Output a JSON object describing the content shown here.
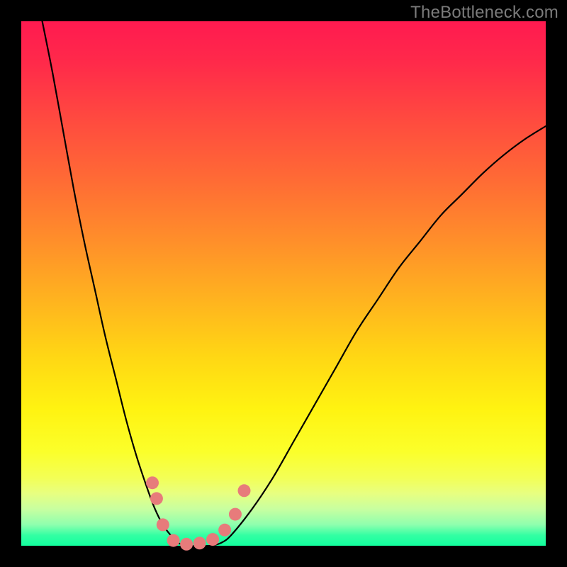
{
  "watermark": "TheBottleneck.com",
  "colors": {
    "frame": "#000000",
    "curve": "#000000",
    "marker_fill": "#e77b7b",
    "marker_stroke": "#d86a6a"
  },
  "chart_data": {
    "type": "line",
    "title": "",
    "xlabel": "",
    "ylabel": "",
    "xlim": [
      0,
      100
    ],
    "ylim": [
      0,
      100
    ],
    "note": "No axis ticks or numeric labels are rendered; values are in percent of plot area. y=0 is bottom edge, y=100 is top edge.",
    "series": [
      {
        "name": "left-branch",
        "x": [
          4,
          6,
          8,
          10,
          12,
          14,
          16,
          18,
          20,
          22,
          24,
          25.5,
          27,
          28.5,
          30
        ],
        "y": [
          100,
          90,
          79,
          68,
          58,
          49,
          40,
          32,
          24,
          17,
          11,
          7,
          4,
          2,
          0.5
        ]
      },
      {
        "name": "valley-floor",
        "x": [
          30,
          32,
          34,
          36,
          38
        ],
        "y": [
          0.5,
          0,
          0,
          0,
          0.5
        ]
      },
      {
        "name": "right-branch",
        "x": [
          38,
          40,
          44,
          48,
          52,
          56,
          60,
          64,
          68,
          72,
          76,
          80,
          84,
          88,
          92,
          96,
          100
        ],
        "y": [
          0.5,
          2,
          7,
          13,
          20,
          27,
          34,
          41,
          47,
          53,
          58,
          63,
          67,
          71,
          74.5,
          77.5,
          80
        ]
      }
    ],
    "markers": {
      "name": "highlighted-points",
      "x": [
        25.0,
        25.8,
        27.0,
        29.0,
        31.5,
        34.0,
        36.5,
        38.8,
        40.8,
        42.5
      ],
      "y": [
        12.0,
        9.0,
        4.0,
        1.0,
        0.3,
        0.5,
        1.2,
        3.0,
        6.0,
        10.5
      ]
    }
  }
}
